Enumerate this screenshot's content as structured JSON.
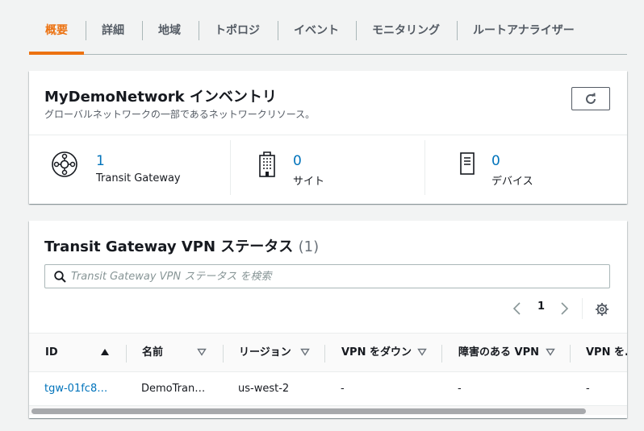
{
  "tabs": [
    {
      "label": "概要",
      "active": true
    },
    {
      "label": "詳細"
    },
    {
      "label": "地域"
    },
    {
      "label": "トポロジ"
    },
    {
      "label": "イベント"
    },
    {
      "label": "モニタリング"
    },
    {
      "label": "ルートアナライザー"
    }
  ],
  "inventory": {
    "title": "MyDemoNetwork インベントリ",
    "description": "グローバルネットワークの一部であるネットワークリソース。",
    "refresh_icon": "refresh-icon",
    "stats": [
      {
        "icon": "transit-gateway-icon",
        "value": "1",
        "label": "Transit Gateway"
      },
      {
        "icon": "building-icon",
        "value": "0",
        "label": "サイト"
      },
      {
        "icon": "device-icon",
        "value": "0",
        "label": "デバイス"
      }
    ]
  },
  "vpn_status": {
    "title": "Transit Gateway VPN ステータス",
    "count": "(1)",
    "search_placeholder": "Transit Gateway VPN ステータス を検索",
    "page": "1",
    "columns": [
      "ID",
      "名前",
      "リージョン",
      "VPN をダウン",
      "障害のある VPN",
      "VPN を..."
    ],
    "rows": [
      [
        "tgw-01fc8…",
        "DemoTran…",
        "us-west-2",
        "-",
        "-",
        "-"
      ]
    ]
  },
  "colors": {
    "accent": "#ec7211",
    "link": "#0073bb"
  }
}
